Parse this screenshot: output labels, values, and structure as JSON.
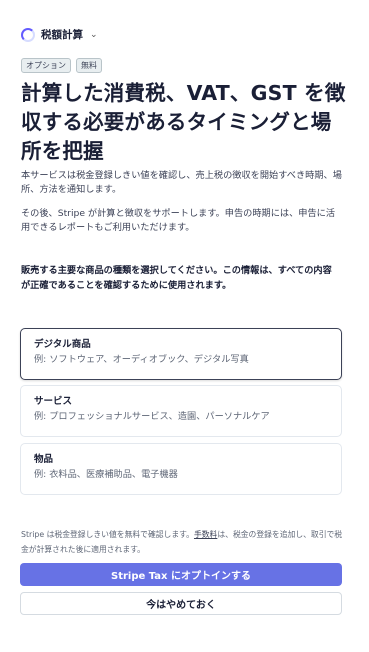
{
  "header": {
    "title": "税額計算",
    "spinner_icon": "loading-spinner-icon",
    "chevron_icon": "chevron-down-icon"
  },
  "badges": [
    "オプション",
    "無料"
  ],
  "headline": "計算した消費税、VAT、GST を徴収する必要があるタイミングと場所を把握",
  "description_1": "本サービスは税金登録しきい値を確認し、売上税の徴収を開始すべき時期、場所、方法を通知します。",
  "description_2": "その後、Stripe が計算と徴収をサポートします。申告の時期には、申告に活用できるレポートもご利用いただけます。",
  "question": "販売する主要な商品の種類を選択してください。この情報は、すべての内容が正確であることを確認するために使用されます。",
  "options": [
    {
      "title": "デジタル商品",
      "desc": "例: ソフトウェア、オーディオブック、デジタル写真",
      "selected": true
    },
    {
      "title": "サービス",
      "desc": "例: プロフェッショナルサービス、造園、パーソナルケア",
      "selected": false
    },
    {
      "title": "物品",
      "desc": "例: 衣料品、医療補助品、電子機器",
      "selected": false
    }
  ],
  "footnote": {
    "before": "Stripe は税金登録しきい値を無料で確認します。",
    "link": "手数料",
    "after": "は、税金の登録を追加し、取引で税金が計算された後に適用されます。"
  },
  "buttons": {
    "primary": "Stripe Tax にオプトインする",
    "secondary": "今はやめておく"
  },
  "colors": {
    "accent": "#635bff",
    "primary_button": "#6772e5"
  }
}
